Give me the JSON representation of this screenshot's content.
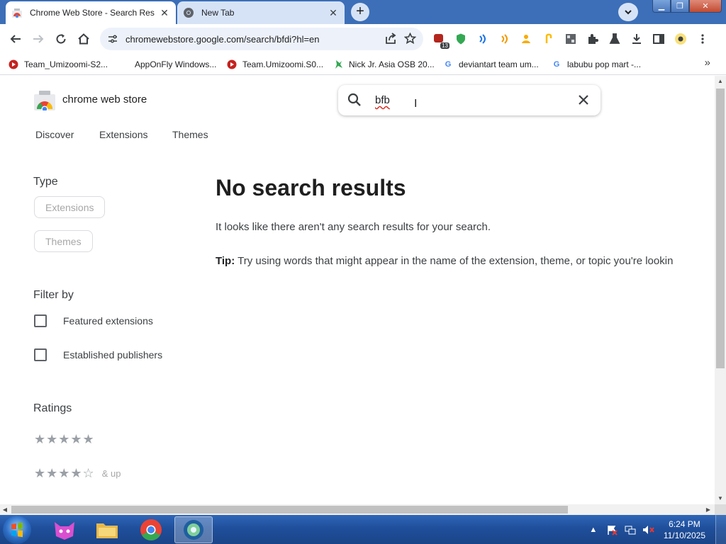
{
  "browser": {
    "tabs": [
      {
        "title": "Chrome Web Store - Search Res",
        "active": true
      },
      {
        "title": "New Tab",
        "active": false
      }
    ],
    "new_tab_label": "+",
    "address": "chromewebstore.google.com/search/bfdi?hl=en",
    "bookmarks": [
      {
        "label": "Team_Umizoomi-S2..."
      },
      {
        "label": "AppOnFly Windows..."
      },
      {
        "label": "Team.Umizoomi.S0..."
      },
      {
        "label": "Nick Jr. Asia OSB 20..."
      },
      {
        "label": "deviantart team um..."
      },
      {
        "label": "labubu pop mart -..."
      }
    ],
    "bookmarks_more": "»",
    "extension_badge": "13"
  },
  "store": {
    "name": "chrome web store",
    "search_query": "bfb",
    "nav": [
      "Discover",
      "Extensions",
      "Themes"
    ],
    "filters": {
      "type_heading": "Type",
      "type_chips": [
        "Extensions",
        "Themes"
      ],
      "filter_heading": "Filter by",
      "checkboxes": [
        "Featured extensions",
        "Established publishers"
      ],
      "ratings_heading": "Ratings",
      "ratings": [
        {
          "stars": "★★★★★",
          "suffix": ""
        },
        {
          "stars": "★★★★☆",
          "suffix": "& up"
        }
      ]
    },
    "results": {
      "heading": "No search results",
      "message": "It looks like there aren't any search results for your search.",
      "tip_label": "Tip:",
      "tip_text": " Try using words that might appear in the name of the extension, theme, or topic you're lookin"
    }
  },
  "taskbar": {
    "time": "6:24 PM",
    "date": "11/10/2025"
  },
  "colors": {
    "tabstrip": "#3c6fb8",
    "omnibox": "#edf2fa",
    "taskbar": "#1f4f9b"
  }
}
